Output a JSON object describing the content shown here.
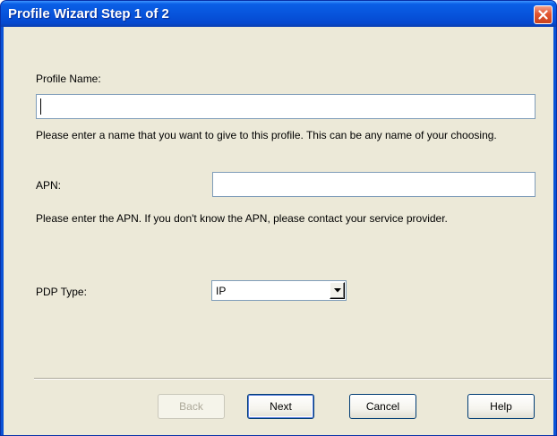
{
  "window": {
    "title": "Profile Wizard Step 1 of 2"
  },
  "form": {
    "profile_name_label": "Profile Name:",
    "profile_name_value": "",
    "profile_name_help": "Please enter a name that you want to give to this profile. This can be any name of your choosing.",
    "apn_label": "APN:",
    "apn_value": "",
    "apn_help": "Please enter the APN.  If you don't know the APN, please contact your service provider.",
    "pdp_label": "PDP Type:",
    "pdp_value": "IP"
  },
  "buttons": {
    "back": "Back",
    "next": "Next",
    "cancel": "Cancel",
    "help": "Help"
  },
  "icons": {
    "close": "close-icon",
    "dropdown": "chevron-down-icon"
  },
  "colors": {
    "titlebar": "#0754dc",
    "close_button": "#e2552f",
    "dialog_bg": "#ece9d8",
    "input_border": "#7f9db9"
  }
}
